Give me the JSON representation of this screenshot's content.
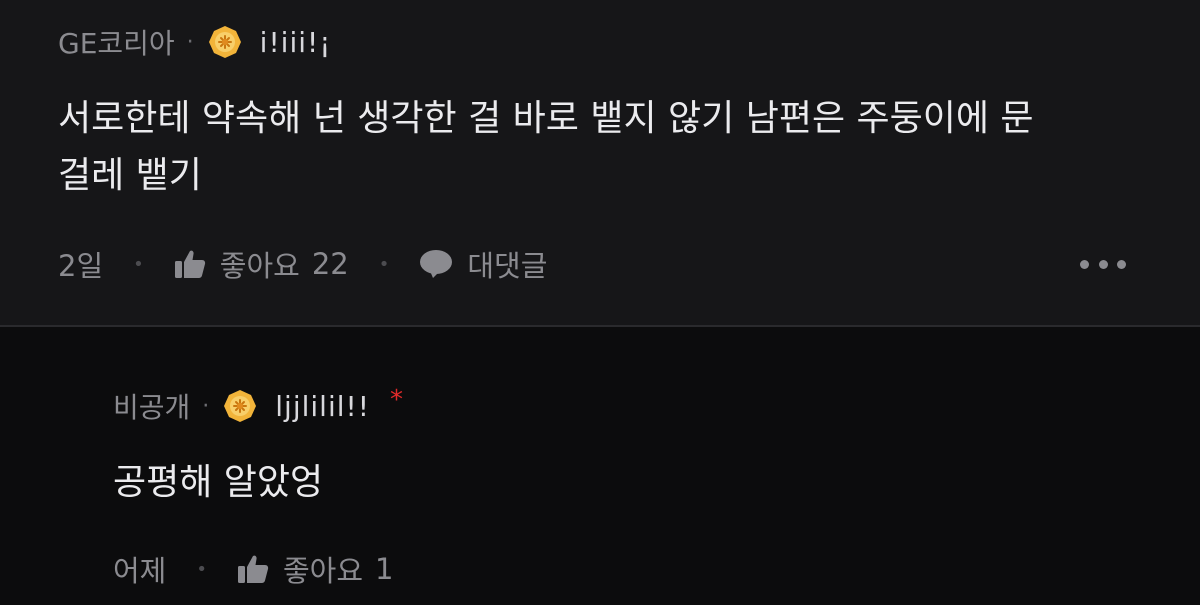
{
  "comments": [
    {
      "author": "GE코리아",
      "separator": "·",
      "badge_icon": "sun-badge-icon",
      "nickname": "i!iii!¡",
      "text": "서로한테 약속해 넌 생각한 걸 바로 뱉지 않기 남편은 주둥이에 문\n걸레 뱉기",
      "time": "2일",
      "like_label": "좋아요",
      "like_count": "22",
      "reply_label": "대댓글"
    }
  ],
  "replies": [
    {
      "author": "비공개",
      "separator": "·",
      "badge_icon": "sun-badge-icon",
      "nickname": "ljjlilil!!",
      "author_mark": "*",
      "text": "공평해 알았엉",
      "time": "어제",
      "like_label": "좋아요",
      "like_count": "1"
    }
  ],
  "colors": {
    "background": "#0c0c0d",
    "main_comment_bg": "#161618",
    "badge_gold": "#f2b43a",
    "star_red": "#e02a2a"
  }
}
